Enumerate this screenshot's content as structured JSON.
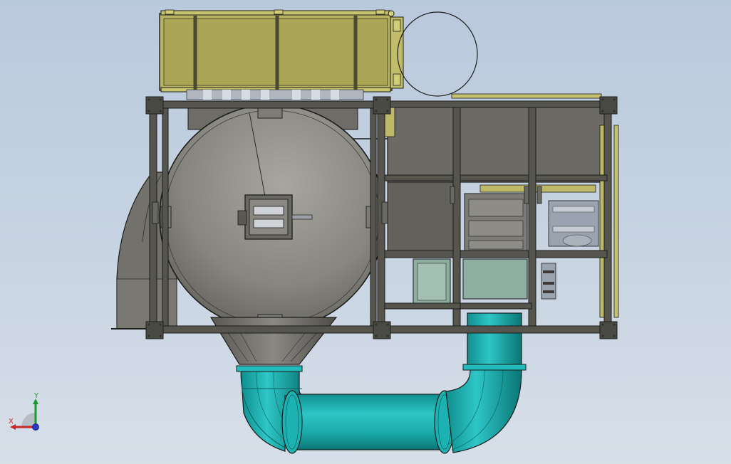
{
  "viewport": {
    "background_top": "#b9c9dc",
    "background_bottom": "#d7dfe9"
  },
  "model": {
    "colors": {
      "frame": "#55554e",
      "frame_dark": "#2f2f2b",
      "vessel": "#8c8a85",
      "vessel_dark": "#5f5d58",
      "housing": "#6f6d68",
      "panel_olive": "#b9b563",
      "pipe_teal": "#1fb5b5",
      "pipe_teal_dark": "#128c8c",
      "glass": "#8fb0a4",
      "outline": "#1c1c1a"
    }
  },
  "triad": {
    "x_label": "X",
    "y_label": "Y",
    "x_color": "#c8282a",
    "y_color": "#1a9a2a",
    "z_color": "#2a3ac8"
  }
}
